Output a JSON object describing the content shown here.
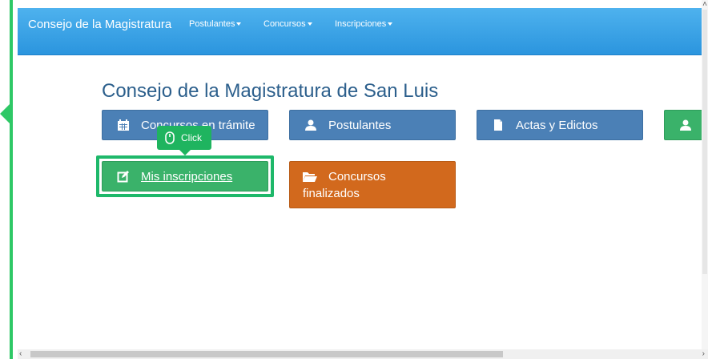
{
  "navbar": {
    "brand": "Consejo de la Magistratura",
    "items": [
      {
        "label": "Postulantes"
      },
      {
        "label": "Concursos"
      },
      {
        "label": "Inscripciones"
      }
    ]
  },
  "main": {
    "title": "Consejo de la Magistratura de San Luis",
    "buttons": {
      "concursos_tramite": "Concursos en trámite",
      "postulantes": "Postulantes",
      "actas_edictos": "Actas y Edictos",
      "mis_inscripciones": "Mis inscripciones",
      "concursos_finalizados_1": "Concursos",
      "concursos_finalizados_2": "finalizados"
    }
  },
  "tooltip": {
    "label": "Click"
  },
  "colors": {
    "navbar": "#2b95de",
    "primary_button": "#4b80b6",
    "success_button": "#3ab26a",
    "warning_button": "#d2691d",
    "highlight": "#1eb86a"
  }
}
